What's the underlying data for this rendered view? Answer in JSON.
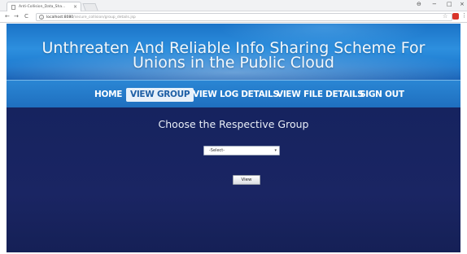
{
  "browser": {
    "tab_title": "Anti-Collision_Data_Sha...",
    "tab_close": "×",
    "url_host": "localhost:8080",
    "url_path": "/secure_collision/group_details.jsp",
    "info_glyph": "i",
    "back": "←",
    "forward": "→",
    "reload": "C",
    "star": "☆",
    "menu": "⋮",
    "minimize": "−",
    "maximize": "□",
    "close": "×",
    "account": "⊖"
  },
  "header": {
    "title": "Unthreaten And Reliable Info Sharing Scheme For Unions in the Public Cloud"
  },
  "nav": {
    "items": [
      {
        "label": "HOME"
      },
      {
        "label": "VIEW GROUP"
      },
      {
        "label": "VIEW LOG DETAILS"
      },
      {
        "label": "VIEW FILE DETAILS"
      },
      {
        "label": "SIGN OUT"
      }
    ],
    "active_index": 1
  },
  "content": {
    "heading": "Choose the Respective Group",
    "select_value": "-Select-",
    "select_arrow": "▾",
    "view_button": "View"
  },
  "colors": {
    "header_blue": "#2d8fde",
    "nav_blue": "#1f6fbf",
    "content_navy": "#17235c"
  }
}
